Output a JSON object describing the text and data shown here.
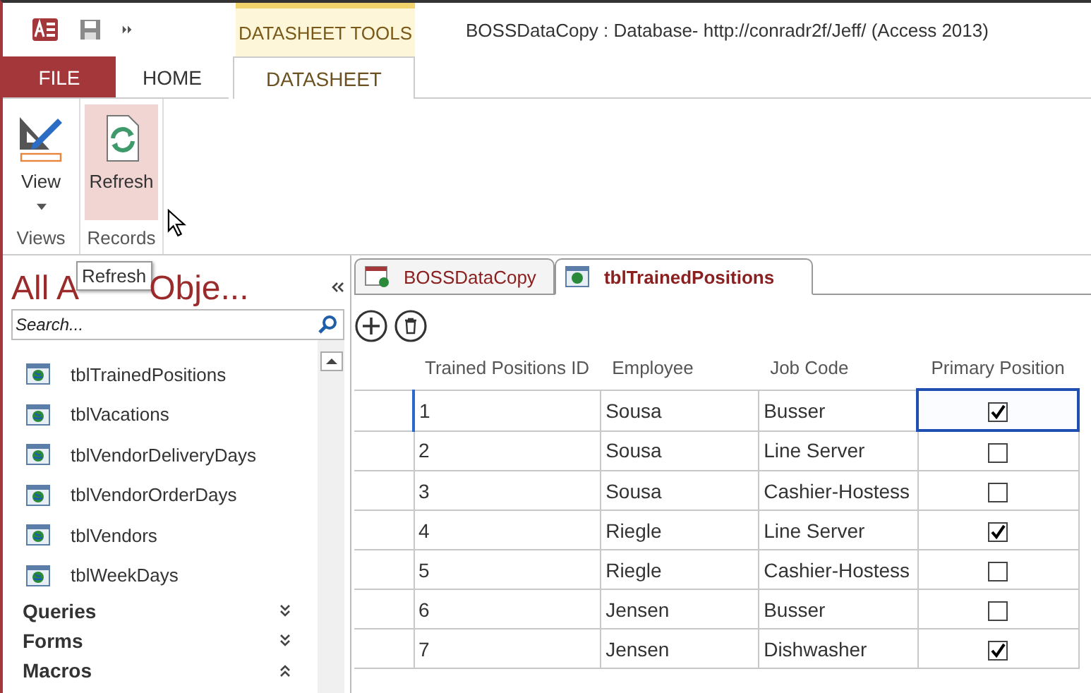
{
  "window": {
    "title": "BOSSDataCopy : Database- http://conradr2f/Jeff/ (Access 2013)"
  },
  "contextual_tab": {
    "label": "DATASHEET TOOLS"
  },
  "ribbon_tabs": [
    {
      "label": "FILE",
      "kind": "file",
      "selected": false
    },
    {
      "label": "HOME",
      "kind": "tab",
      "selected": false
    },
    {
      "label": "DATASHEET",
      "kind": "tab",
      "selected": true
    }
  ],
  "ribbon_groups": [
    {
      "label": "Views",
      "buttons": [
        {
          "label": "View",
          "kind": "view",
          "hovered": false,
          "dropdown": true
        }
      ]
    },
    {
      "label": "Records",
      "buttons": [
        {
          "label": "Refresh",
          "kind": "refresh",
          "hovered": true,
          "dropdown": false
        }
      ]
    }
  ],
  "tooltip": {
    "text": "Refresh"
  },
  "nav_pane": {
    "title_before": "All A",
    "title_after": "Obje...",
    "search": {
      "placeholder": "Search..."
    },
    "items": [
      {
        "label": "tblTrainedPositions"
      },
      {
        "label": "tblVacations"
      },
      {
        "label": "tblVendorDeliveryDays"
      },
      {
        "label": "tblVendorOrderDays"
      },
      {
        "label": "tblVendors"
      },
      {
        "label": "tblWeekDays"
      }
    ],
    "sections": [
      {
        "label": "Queries",
        "expanded": false
      },
      {
        "label": "Forms",
        "expanded": false
      },
      {
        "label": "Macros",
        "expanded": true
      }
    ]
  },
  "doc_tabs": [
    {
      "label": "BOSSDataCopy",
      "kind": "database",
      "selected": false
    },
    {
      "label": "tblTrainedPositions",
      "kind": "table",
      "selected": true
    }
  ],
  "table": {
    "columns": [
      "Trained Positions ID",
      "Employee",
      "Job Code",
      "Primary Position"
    ],
    "rows": [
      {
        "id": "1",
        "employee": "Sousa",
        "job_code": "Busser",
        "primary": true,
        "focused": true
      },
      {
        "id": "2",
        "employee": "Sousa",
        "job_code": "Line Server",
        "primary": false,
        "focused": false
      },
      {
        "id": "3",
        "employee": "Sousa",
        "job_code": "Cashier-Hostess",
        "primary": false,
        "focused": false
      },
      {
        "id": "4",
        "employee": "Riegle",
        "job_code": "Line Server",
        "primary": true,
        "focused": false
      },
      {
        "id": "5",
        "employee": "Riegle",
        "job_code": "Cashier-Hostess",
        "primary": false,
        "focused": false
      },
      {
        "id": "6",
        "employee": "Jensen",
        "job_code": "Busser",
        "primary": false,
        "focused": false
      },
      {
        "id": "7",
        "employee": "Jensen",
        "job_code": "Dishwasher",
        "primary": true,
        "focused": false
      }
    ]
  }
}
